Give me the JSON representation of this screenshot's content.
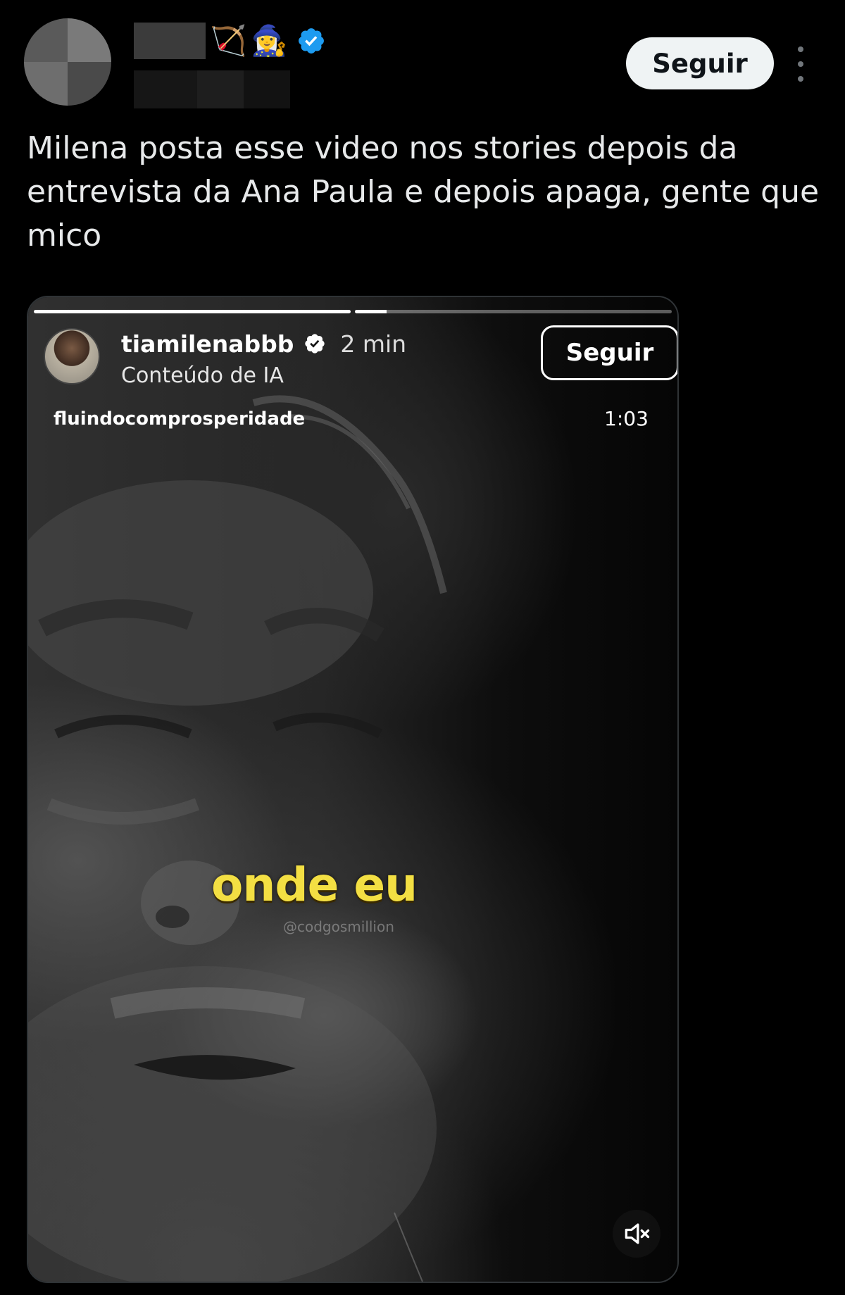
{
  "tweet": {
    "follow_label": "Seguir",
    "text": "Milena posta esse video nos stories depois da entrevista da Ana Paula e depois apaga, gente que mico",
    "name_emojis": [
      "🏹",
      "🧙‍♀️"
    ],
    "verified_color": "#1d9bf0"
  },
  "story": {
    "username": "tiamilenabbb",
    "time_ago": "2 min",
    "subtitle": "Conteúdo de IA",
    "follow_label": "Seguir",
    "audio_source": "fluindocomprosperidade",
    "duration": "1:03",
    "caption": "onde eu",
    "watermark": "@codgosmillion",
    "caption_color": "#f3df43",
    "progress_segments": [
      1.0,
      0.1
    ]
  }
}
